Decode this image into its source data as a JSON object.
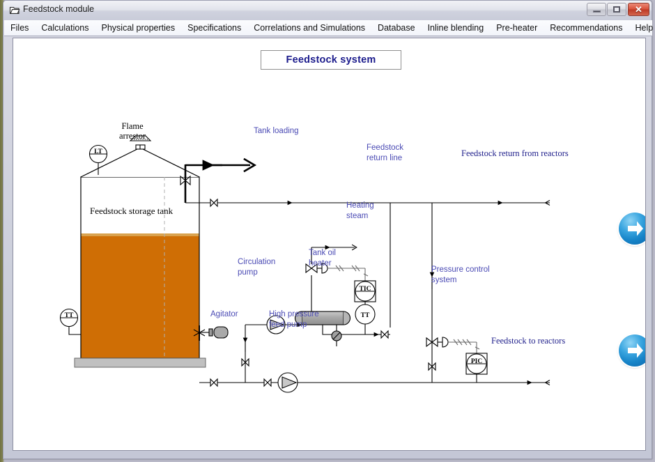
{
  "window": {
    "title": "Feedstock module",
    "icon": "window-folder-icon",
    "caption_buttons": {
      "minimize": "minimize-button",
      "maximize": "maximize-button",
      "close_label": "✕"
    }
  },
  "menubar": {
    "items": [
      {
        "label": "Files"
      },
      {
        "label": "Calculations"
      },
      {
        "label": "Physical properties"
      },
      {
        "label": "Specifications"
      },
      {
        "label": "Correlations and Simulations"
      },
      {
        "label": "Database"
      },
      {
        "label": "Inline blending"
      },
      {
        "label": "Pre-heater"
      },
      {
        "label": "Recommendations"
      },
      {
        "label": "Help"
      }
    ]
  },
  "banner": {
    "title": "Feedstock system"
  },
  "navigation": {
    "next_top": "next-page-arrow",
    "next_bottom": "next-page-arrow"
  },
  "diagram": {
    "labels": {
      "flame_arrestor": "Flame\narrestor",
      "tank_name": "Feedstock storage tank",
      "tank_loading": "Tank loading",
      "feedstock_return_line": "Feedstock\nreturn line",
      "feedstock_return_from_reactors": "Feedstock return from reactors",
      "heating_steam": "Heating\nsteam",
      "tank_oil_heater": "Tank oil\nheater",
      "circulation_pump": "Circulation\npump",
      "agitator": "Agitator",
      "high_pressure_feed_pump": "High pressure\nfeed pump",
      "pressure_control_system": "Pressure control\nsystem",
      "feedstock_to_reactors": "Feedstock to reactors"
    },
    "instruments": [
      {
        "tag": "LT",
        "name": "level-transmitter"
      },
      {
        "tag": "TT",
        "name": "tank-temperature-transmitter"
      },
      {
        "tag": "TIC",
        "name": "temperature-indicating-controller"
      },
      {
        "tag": "TT",
        "name": "heater-temperature-transmitter"
      },
      {
        "tag": "PIC",
        "name": "pressure-indicating-controller"
      }
    ],
    "colors": {
      "liquid": "#cf6e05",
      "foundation": "#c0c0c0",
      "equipment": "#a6a6a6",
      "label_sans": "#4a4ab4",
      "label_serif": "#21218c",
      "banner_text": "#1b1b8c",
      "line": "#000000"
    }
  }
}
